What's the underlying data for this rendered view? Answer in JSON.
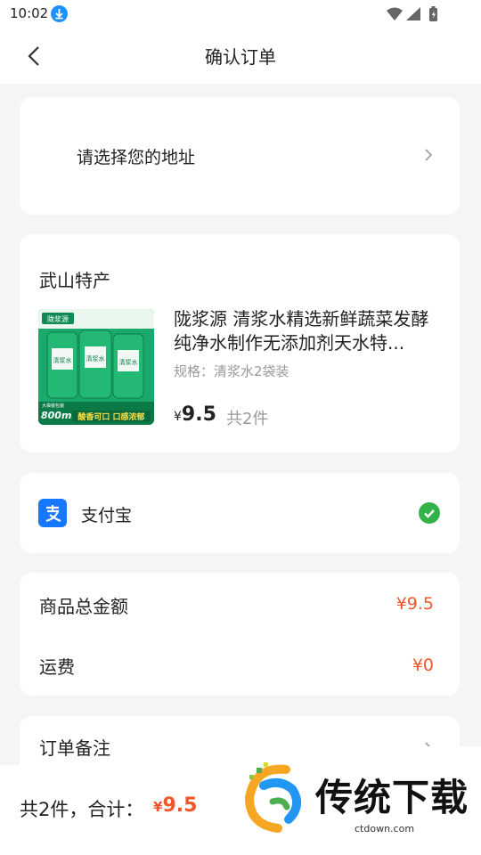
{
  "status_bar": {
    "time": "10:02"
  },
  "header": {
    "title": "确认订单"
  },
  "address": {
    "placeholder": "请选择您的地址"
  },
  "product": {
    "shop_name": "武山特产",
    "title": "陇浆源 清浆水精选新鲜蔬菜发酵纯净水制作无添加剂天水特...",
    "spec": "规格：清浆水2袋装",
    "price_symbol": "¥",
    "price": "9.5",
    "quantity": "共2件",
    "image_text": {
      "badge": "陇浆源",
      "left_tag": "大袋装包装",
      "volume": "800ml",
      "slogan": "酸香可口 口感浓郁",
      "bag_label": "清浆水"
    }
  },
  "payment": {
    "method": "支付宝"
  },
  "summary": {
    "goods_total_label": "商品总金额",
    "goods_total_value": "¥9.5",
    "shipping_label": "运费",
    "shipping_value": "¥0"
  },
  "note": {
    "label": "订单备注"
  },
  "footer": {
    "total_prefix": "共2件，合计：",
    "total_symbol": "¥",
    "total_value": "9.5"
  },
  "watermark": {
    "text": "传统下载",
    "sub": "ctdown.com"
  },
  "colors": {
    "accent": "#f0562a",
    "alipay": "#1677ff",
    "check": "#34b24a",
    "background": "#f5f5f5"
  }
}
